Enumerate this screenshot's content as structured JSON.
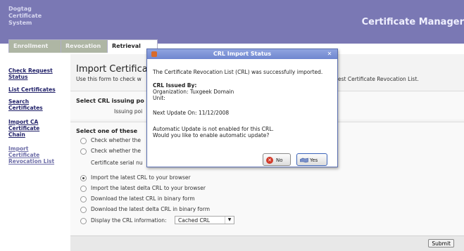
{
  "app": {
    "title_lines": [
      "Dogtag",
      "Certificate",
      "System"
    ],
    "header_right": "Certificate Manager"
  },
  "tabs": [
    {
      "label": "Enrollment",
      "active": false
    },
    {
      "label": "Revocation",
      "active": false
    },
    {
      "label": "Retrieval",
      "active": true
    }
  ],
  "sidebar": {
    "items": [
      {
        "lines": [
          "Check Request",
          "Status"
        ]
      },
      {
        "lines": [
          "List Certificates"
        ]
      },
      {
        "lines": [
          "Search",
          "Certificates"
        ]
      },
      {
        "lines": [
          "Import CA",
          "Certificate",
          "Chain"
        ]
      },
      {
        "lines": [
          "Import",
          "Certificate",
          "Revocation List"
        ]
      }
    ]
  },
  "main": {
    "title": "Import Certificat",
    "description": "Use this form to check w",
    "description_right": "est Certificate Revocation List.",
    "section1": {
      "title": "Select CRL issuing po",
      "field_label": "Issuing poi"
    },
    "section2": {
      "title": "Select one of these",
      "options": [
        {
          "label": "Check whether the",
          "checked": false
        },
        {
          "label": "Check whether the",
          "checked": false
        },
        {
          "label": "Import the latest CRL to your browser",
          "checked": true
        },
        {
          "label": "Import the latest delta CRL to your browser",
          "checked": false
        },
        {
          "label": "Download the latest CRL in binary form",
          "checked": false
        },
        {
          "label": "Download the latest delta CRL in binary form",
          "checked": false
        },
        {
          "label": "Display the CRL information:",
          "checked": false
        }
      ],
      "serial_label": "Certificate serial nu",
      "display_select": "Cached CRL"
    },
    "submit_label": "Submit"
  },
  "dialog": {
    "title": "CRL Import Status",
    "message": "The Certificate Revocation List (CRL) was successfully imported.",
    "issued_by_label": "CRL Issued By:",
    "organization": "Organization: Tuxgeek Domain",
    "unit": "Unit:",
    "next_update": "Next Update On: 11/12/2008",
    "auto_update_line1": "Automatic Update is not enabled for this CRL.",
    "auto_update_line2": "Would you like to enable automatic update?",
    "no_label": "No",
    "yes_label": "Yes"
  }
}
